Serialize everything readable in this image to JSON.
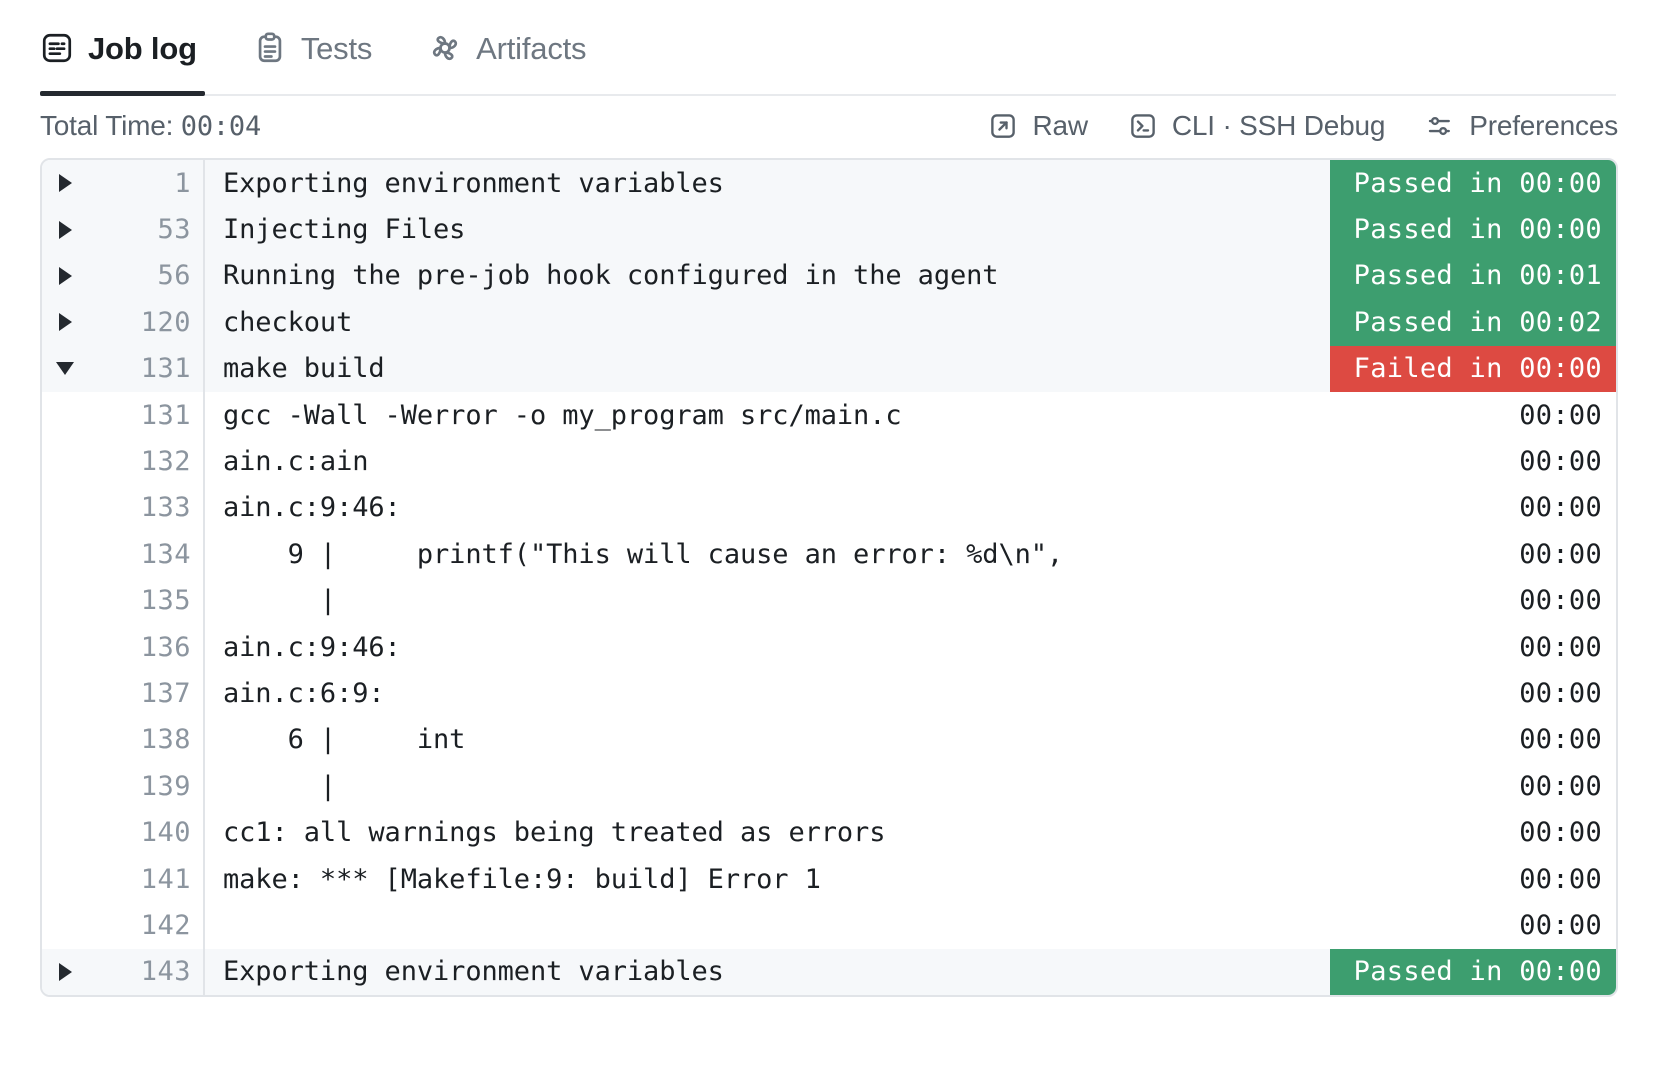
{
  "tabs": [
    {
      "label": "Job log",
      "icon": "joblog-icon",
      "active": true
    },
    {
      "label": "Tests",
      "icon": "clipboard-icon",
      "active": false
    },
    {
      "label": "Artifacts",
      "icon": "artifacts-icon",
      "active": false
    }
  ],
  "toolbar": {
    "total_time_label": "Total Time: ",
    "total_time_value": "00:04",
    "actions": [
      {
        "label": "Raw",
        "icon": "external-link-icon"
      },
      {
        "label": "CLI · SSH Debug",
        "icon": "terminal-icon"
      },
      {
        "label": "Preferences",
        "icon": "sliders-icon"
      }
    ]
  },
  "colors": {
    "passed": "#3d9e6f",
    "failed": "#dd4a42",
    "accent": "#24292f"
  },
  "log": {
    "rows": [
      {
        "lineno": "1",
        "text": "Exporting environment variables",
        "caret": "right",
        "kind": "section",
        "status": "Passed in 00:00",
        "status_kind": "passed"
      },
      {
        "lineno": "53",
        "text": "Injecting Files",
        "caret": "right",
        "kind": "section",
        "status": "Passed in 00:00",
        "status_kind": "passed"
      },
      {
        "lineno": "56",
        "text": "Running the pre-job hook configured in the agent",
        "caret": "right",
        "kind": "section",
        "status": "Passed in 00:01",
        "status_kind": "passed"
      },
      {
        "lineno": "120",
        "text": "checkout",
        "caret": "right",
        "kind": "section",
        "status": "Passed in 00:02",
        "status_kind": "passed"
      },
      {
        "lineno": "131",
        "text": "make build",
        "caret": "down",
        "kind": "section",
        "status": "Failed in 00:00",
        "status_kind": "failed"
      },
      {
        "lineno": "131",
        "text": "gcc -Wall -Werror -o my_program src/main.c",
        "caret": "none",
        "kind": "body",
        "status": "00:00",
        "status_kind": "plain"
      },
      {
        "lineno": "132",
        "text": "ain.c:ain",
        "caret": "none",
        "kind": "body",
        "status": "00:00",
        "status_kind": "plain"
      },
      {
        "lineno": "133",
        "text": "ain.c:9:46:",
        "caret": "none",
        "kind": "body",
        "status": "00:00",
        "status_kind": "plain"
      },
      {
        "lineno": "134",
        "text": "    9 |     printf(\"This will cause an error: %d\\n\",",
        "caret": "none",
        "kind": "body",
        "status": "00:00",
        "status_kind": "plain"
      },
      {
        "lineno": "135",
        "text": "      |",
        "caret": "none",
        "kind": "body",
        "status": "00:00",
        "status_kind": "plain"
      },
      {
        "lineno": "136",
        "text": "ain.c:9:46:",
        "caret": "none",
        "kind": "body",
        "status": "00:00",
        "status_kind": "plain"
      },
      {
        "lineno": "137",
        "text": "ain.c:6:9:",
        "caret": "none",
        "kind": "body",
        "status": "00:00",
        "status_kind": "plain"
      },
      {
        "lineno": "138",
        "text": "    6 |     int",
        "caret": "none",
        "kind": "body",
        "status": "00:00",
        "status_kind": "plain"
      },
      {
        "lineno": "139",
        "text": "      |",
        "caret": "none",
        "kind": "body",
        "status": "00:00",
        "status_kind": "plain"
      },
      {
        "lineno": "140",
        "text": "cc1: all warnings being treated as errors",
        "caret": "none",
        "kind": "body",
        "status": "00:00",
        "status_kind": "plain"
      },
      {
        "lineno": "141",
        "text": "make: *** [Makefile:9: build] Error 1",
        "caret": "none",
        "kind": "body",
        "status": "00:00",
        "status_kind": "plain"
      },
      {
        "lineno": "142",
        "text": "",
        "caret": "none",
        "kind": "body",
        "status": "00:00",
        "status_kind": "plain"
      },
      {
        "lineno": "143",
        "text": "Exporting environment variables",
        "caret": "right",
        "kind": "section",
        "status": "Passed in 00:00",
        "status_kind": "passed"
      }
    ]
  }
}
